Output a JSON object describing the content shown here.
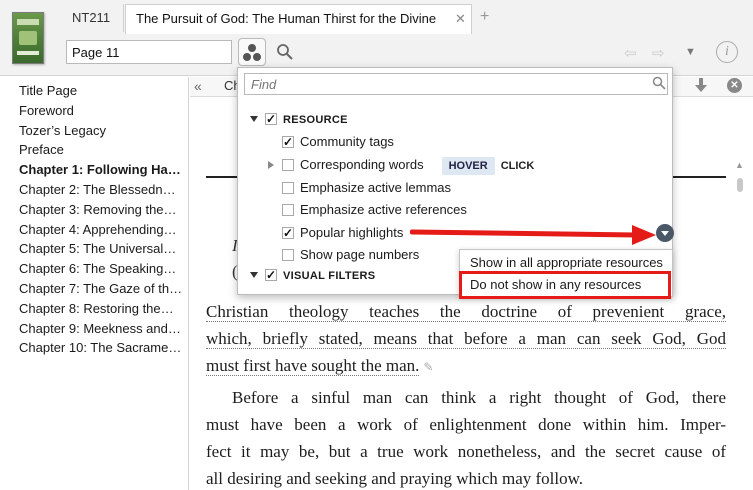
{
  "tabs": {
    "short": "NT211",
    "main_title": "The Pursuit of God: The Human Thirst for the Divine",
    "close_glyph": "✕",
    "add_glyph": "+"
  },
  "toolbar": {
    "page_value": "Page 11",
    "info_glyph": "i"
  },
  "toc": [
    {
      "label": "Title Page",
      "bold": false
    },
    {
      "label": "Foreword",
      "bold": false
    },
    {
      "label": "Tozer’s Legacy",
      "bold": false
    },
    {
      "label": "Preface",
      "bold": false
    },
    {
      "label": "Chapter 1: Following Ha…",
      "bold": true
    },
    {
      "label": "Chapter 2: The Blessedn…",
      "bold": false
    },
    {
      "label": "Chapter 3: Removing the…",
      "bold": false
    },
    {
      "label": "Chapter 4: Apprehending…",
      "bold": false
    },
    {
      "label": "Chapter 5: The Universal…",
      "bold": false
    },
    {
      "label": "Chapter 6: The Speaking…",
      "bold": false
    },
    {
      "label": "Chapter 7: The Gaze of th…",
      "bold": false
    },
    {
      "label": "Chapter 8: Restoring the…",
      "bold": false
    },
    {
      "label": "Chapter 9: Meekness and…",
      "bold": false
    },
    {
      "label": "Chapter 10: The Sacrame…",
      "bold": false
    }
  ],
  "content_toolbar": {
    "collapse_glyph": "«",
    "section_label": "Ch"
  },
  "reading": {
    "frag1": "I",
    "frag2": "(",
    "p1_lines": [
      "Christian theology teaches the doctrine of prevenient grace,",
      "which, briefly stated, means that before a man can seek God, God",
      "must first have sought the man."
    ],
    "p2_lines": [
      "Before a sinful man can think a right thought of God, there",
      "must have been a work of enlightenment done within him. Imper-",
      "fect it may be, but a true work nonetheless, and the secret cause of",
      "all desiring and seeking and praying which may follow."
    ]
  },
  "filter_panel": {
    "find_placeholder": "Find",
    "resource_header": "RESOURCE",
    "items": [
      {
        "label": "Community tags",
        "checked": true
      },
      {
        "label": "Corresponding words",
        "checked": false
      },
      {
        "label": "Emphasize active lemmas",
        "checked": false
      },
      {
        "label": "Emphasize active references",
        "checked": false
      },
      {
        "label": "Popular highlights",
        "checked": true
      },
      {
        "label": "Show page numbers",
        "checked": false
      }
    ],
    "hover_chip": "HOVER",
    "click_label": "CLICK",
    "visual_filters_header": "VISUAL FILTERS"
  },
  "context_menu": {
    "item1": "Show in all appropriate resources",
    "item2": "Do not show in any resources"
  },
  "colors": {
    "annotation_red": "#e41b17",
    "chip_blue": "#dde8f3",
    "options_circle": "#4a5766"
  }
}
